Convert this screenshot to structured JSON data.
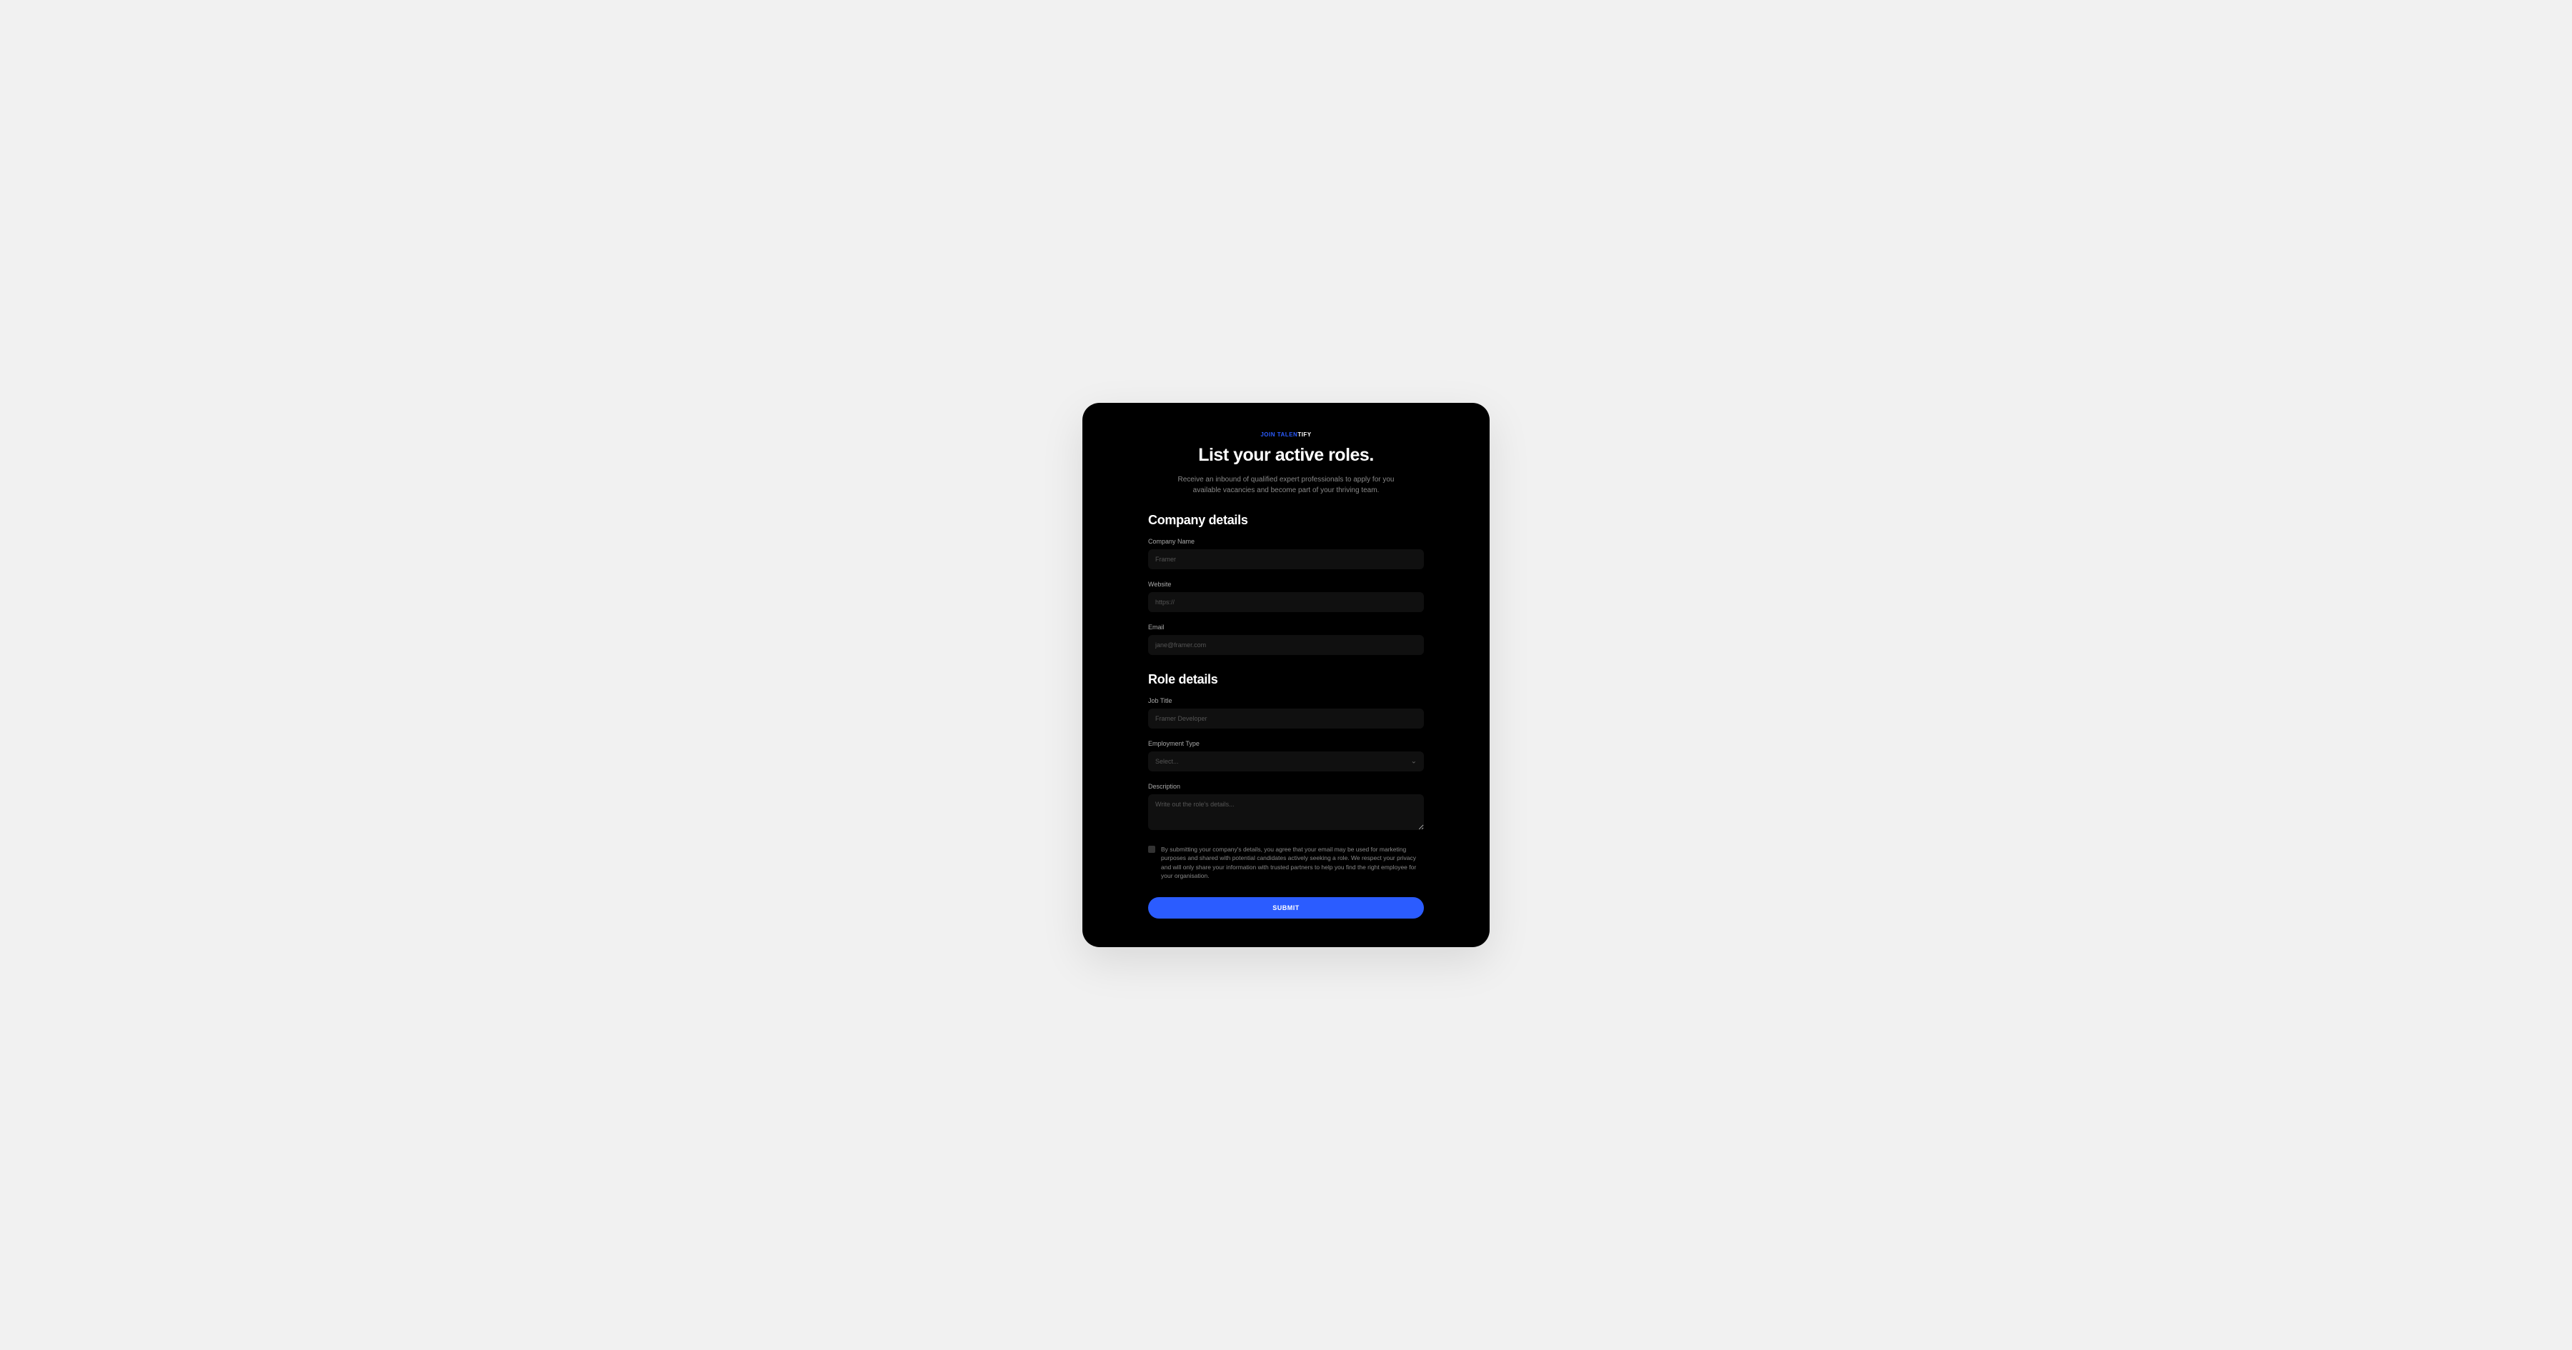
{
  "header": {
    "eyebrow_part1": "JOIN TALEN",
    "eyebrow_part2": "TIFY",
    "title": "List your active roles.",
    "subtitle": "Receive an inbound of qualified expert professionals to apply for you available vacancies and become part of your thriving team."
  },
  "company": {
    "section_title": "Company details",
    "fields": {
      "name": {
        "label": "Company Name",
        "placeholder": "Framer"
      },
      "website": {
        "label": "Website",
        "placeholder": "https://"
      },
      "email": {
        "label": "Email",
        "placeholder": "jane@framer.com"
      }
    }
  },
  "role": {
    "section_title": "Role details",
    "fields": {
      "job_title": {
        "label": "Job Title",
        "placeholder": "Framer Developer"
      },
      "employment_type": {
        "label": "Employment Type",
        "placeholder": "Select..."
      },
      "description": {
        "label": "Description",
        "placeholder": "Write out the role's details..."
      }
    }
  },
  "consent": {
    "text": "By submitting your company's details, you agree that your email may be used for marketing purposes and shared with potential candidates actively seeking a role. We respect your privacy and will only share your information with trusted partners to help you find the right employee for your organisation."
  },
  "submit_label": "SUBMIT"
}
